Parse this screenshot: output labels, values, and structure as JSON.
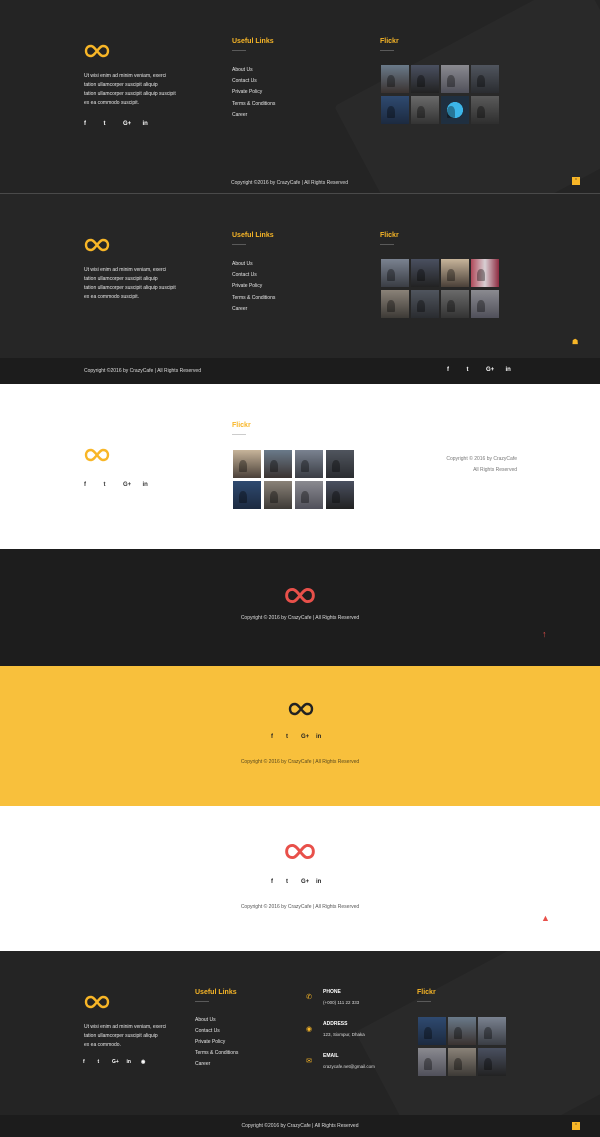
{
  "brand": {
    "logo_icon": "infinity-icon",
    "colors": {
      "accent": "#f8b627",
      "red": "#e8504a",
      "dark": "#242424",
      "yellow_bg": "#f8c03c"
    }
  },
  "common": {
    "description": [
      "Ut wisi enim ad minim veniam, exerci",
      "tation ullamcorper suscipit aliquip",
      "tation ullamcorper suscipit aliquip suscipit",
      "ex ea commodo suscipit."
    ],
    "useful_links_title": "Useful Links",
    "flickr_title": "Flickr",
    "links": [
      "About Us",
      "Contact Us",
      "Private Policy",
      "Terms & Conditions",
      "Career"
    ],
    "social": [
      "f",
      "t",
      "G+",
      "in"
    ],
    "social_icons": [
      "facebook-icon",
      "twitter-icon",
      "google-plus-icon",
      "linkedin-icon"
    ]
  },
  "footer1": {
    "copyright": "Copyright ©2016 by CrazyCafe   |   All Rights Reserved"
  },
  "footer2": {
    "copyright": "Copyright ©2016 by CrazyCafe   |   All Rights Reserved"
  },
  "footer3": {
    "copyright_line1": "Copyright © 2016 by CrazyCafe",
    "copyright_line2": "All Rights Reserved"
  },
  "footer4": {
    "copyright": "Copyright © 2016 by CrazyCafe | All Rights Reserved",
    "scroll_icon": "arrow-up-icon"
  },
  "footer5": {
    "copyright": "Copyright © 2016 by CrazyCafe | All Rights Reserved"
  },
  "footer6": {
    "copyright": "Copyright © 2016 by CrazyCafe | All Rights Reserved",
    "scroll_icon": "rocket-icon"
  },
  "footer7": {
    "description": [
      "Ut wisi enim ad minim veniam, exerci",
      "tation ullamcorper suscipit aliquip",
      "ex ea commodo."
    ],
    "phone_label": "PHONE",
    "phone_value": "(+000) 111 22 333",
    "address_label": "ADDRESS",
    "address_value": "123, Sixmpur, Dhaka",
    "email_label": "EMAIL",
    "email_value": "crazycafe.net@gmail.com",
    "copyright": "Copyright ©2016 by CrazyCafe   |   All Rights Reserved"
  }
}
